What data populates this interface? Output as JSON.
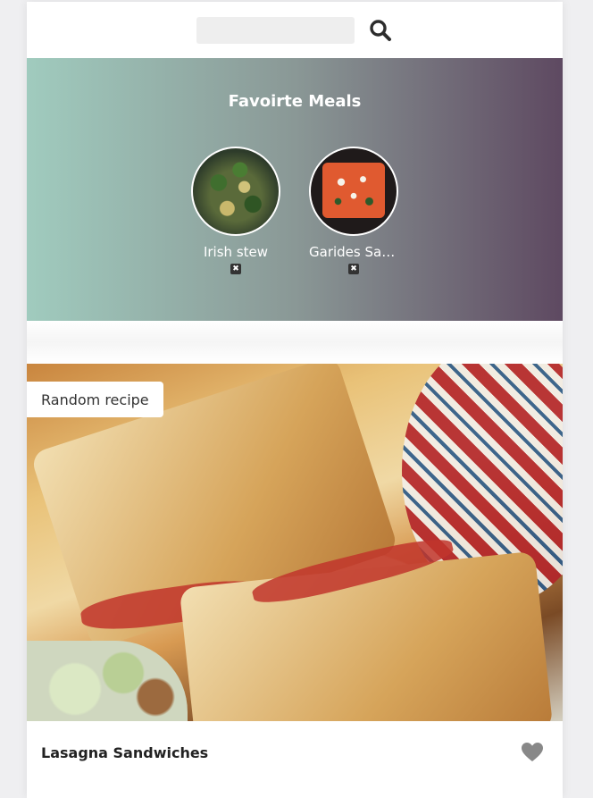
{
  "header": {
    "search_placeholder": "",
    "search_value": ""
  },
  "favorites": {
    "title": "Favoirte Meals",
    "meals": [
      {
        "name": "Irish stew",
        "remove_label": "✖"
      },
      {
        "name": "Garides Saganaki",
        "remove_label": "✖"
      }
    ]
  },
  "random_meal": {
    "tag": "Random recipe",
    "title": "Lasagna Sandwiches",
    "favorited": false
  },
  "icons": {
    "search": "search-icon",
    "heart": "heart-icon",
    "remove": "close-icon"
  },
  "colors": {
    "gradient_start": "#a0cbbe",
    "gradient_end": "#5e4961",
    "heart": "#888888",
    "search_icon": "#2d2d2d"
  }
}
